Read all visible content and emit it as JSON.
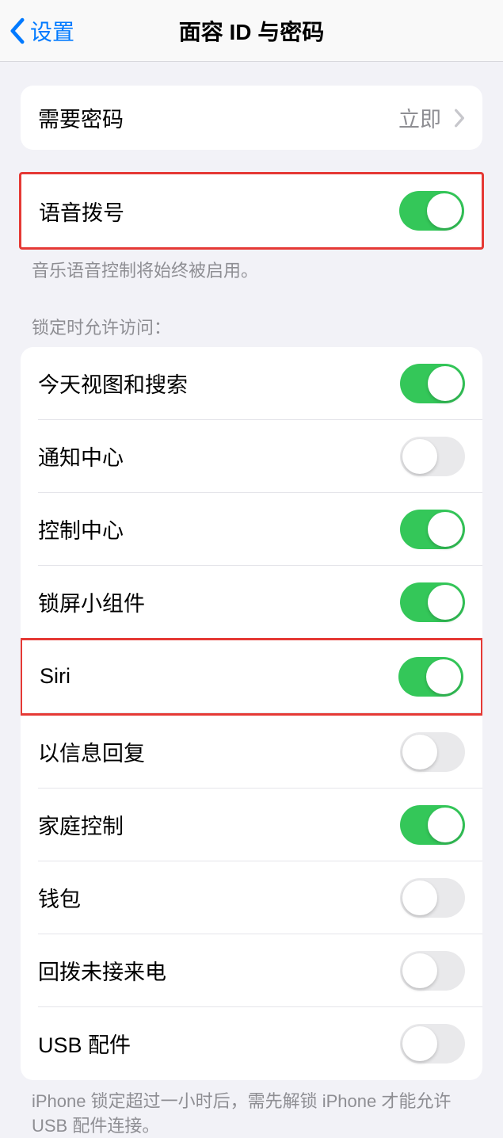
{
  "header": {
    "back_label": "设置",
    "title": "面容 ID 与密码"
  },
  "require_passcode": {
    "label": "需要密码",
    "value": "立即"
  },
  "voice_dial": {
    "label": "语音拨号",
    "on": true,
    "footer": "音乐语音控制将始终被启用。"
  },
  "locked_access": {
    "header": "锁定时允许访问：",
    "items": [
      {
        "label": "今天视图和搜索",
        "on": true
      },
      {
        "label": "通知中心",
        "on": false
      },
      {
        "label": "控制中心",
        "on": true
      },
      {
        "label": "锁屏小组件",
        "on": true
      },
      {
        "label": "Siri",
        "on": true
      },
      {
        "label": "以信息回复",
        "on": false
      },
      {
        "label": "家庭控制",
        "on": true
      },
      {
        "label": "钱包",
        "on": false
      },
      {
        "label": "回拨未接来电",
        "on": false
      },
      {
        "label": "USB 配件",
        "on": false
      }
    ],
    "footer": "iPhone 锁定超过一小时后，需先解锁 iPhone 才能允许USB 配件连接。"
  }
}
